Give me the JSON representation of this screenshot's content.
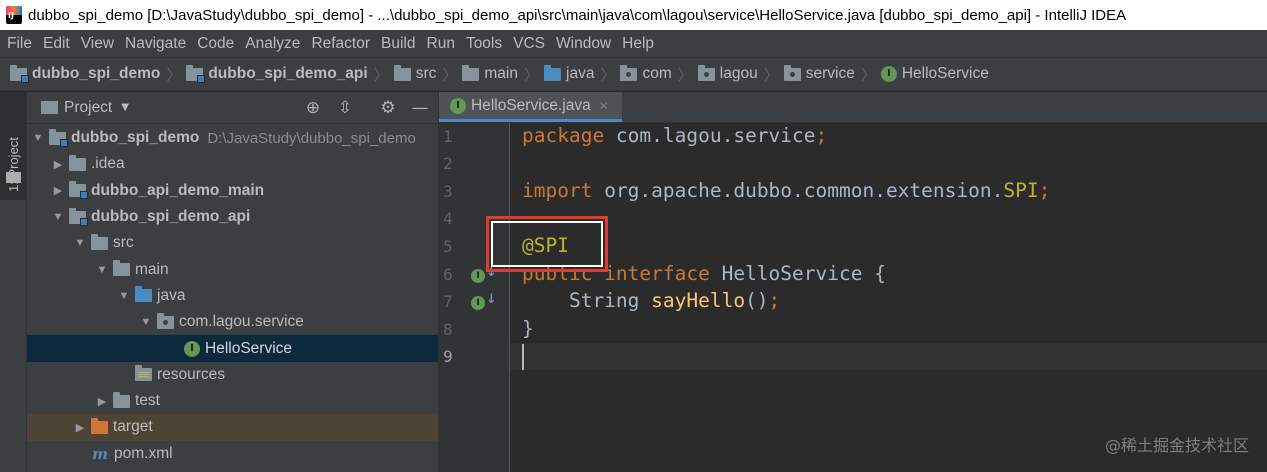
{
  "window": {
    "title": "dubbo_spi_demo [D:\\JavaStudy\\dubbo_spi_demo] - ...\\dubbo_spi_demo_api\\src\\main\\java\\com\\lagou\\service\\HelloService.java [dubbo_spi_demo_api] - IntelliJ IDEA"
  },
  "menu": [
    "File",
    "Edit",
    "View",
    "Navigate",
    "Code",
    "Analyze",
    "Refactor",
    "Build",
    "Run",
    "Tools",
    "VCS",
    "Window",
    "Help"
  ],
  "breadcrumbs": [
    "dubbo_spi_demo",
    "dubbo_spi_demo_api",
    "src",
    "main",
    "java",
    "com",
    "lagou",
    "service",
    "HelloService"
  ],
  "toolstrip": {
    "project_tab": "1: Project"
  },
  "project_panel": {
    "title": "Project",
    "tree": [
      {
        "label": "dubbo_spi_demo",
        "hint": "D:\\JavaStudy\\dubbo_spi_demo"
      },
      {
        "label": ".idea"
      },
      {
        "label": "dubbo_api_demo_main"
      },
      {
        "label": "dubbo_spi_demo_api"
      },
      {
        "label": "src"
      },
      {
        "label": "main"
      },
      {
        "label": "java"
      },
      {
        "label": "com.lagou.service"
      },
      {
        "label": "HelloService"
      },
      {
        "label": "resources"
      },
      {
        "label": "test"
      },
      {
        "label": "target"
      },
      {
        "label": "pom.xml"
      }
    ]
  },
  "editor": {
    "tab_label": "HelloService.java",
    "line_numbers": [
      "1",
      "2",
      "3",
      "4",
      "5",
      "6",
      "7",
      "8",
      "9"
    ],
    "code": {
      "l1_kw": "package",
      "l1_rest": " com.lagou.service",
      "l1_semi": ";",
      "l3_kw": "import",
      "l3_rest": " org.apache.dubbo.common.extension.",
      "l3_spi": "SPI",
      "l3_semi": ";",
      "l5_anno": "@SPI",
      "l6_kw": "public interface",
      "l6_rest": " HelloService {",
      "l7_indent": "    String ",
      "l7_fn": "sayHello",
      "l7_rest": "()",
      "l7_semi": ";",
      "l8": "}"
    }
  },
  "watermark": "@稀土掘金技术社区",
  "colors": {
    "keyword": "#cc7832",
    "annotation": "#bbb529",
    "method": "#ffc66d",
    "text": "#a9b7c6",
    "highlight_border": "#e23b2f"
  }
}
